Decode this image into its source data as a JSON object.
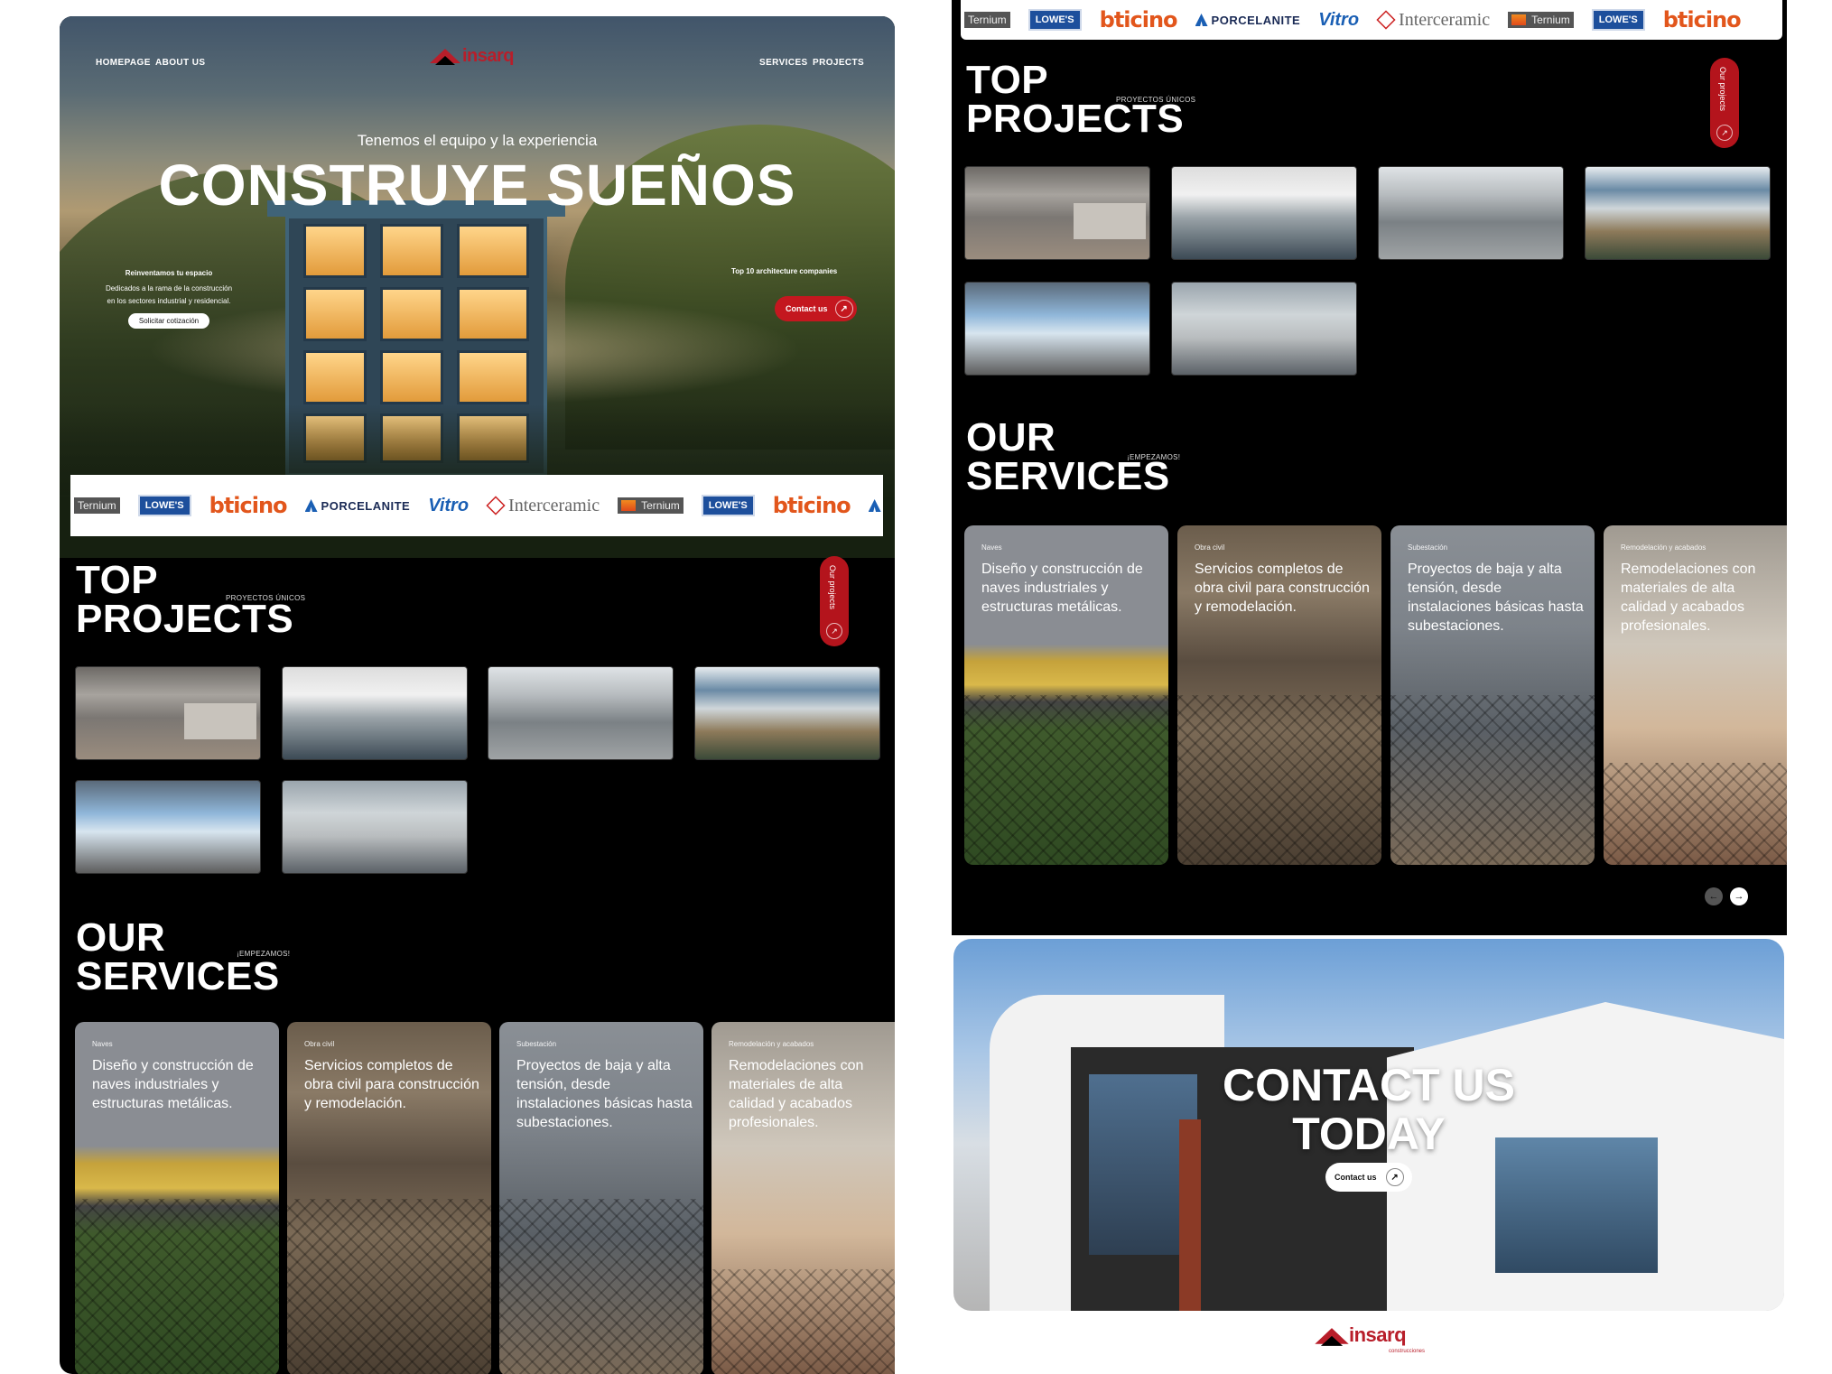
{
  "nav": {
    "left_links": [
      "HOMEPAGE",
      "ABOUT US"
    ],
    "right_links": [
      "SERVICES",
      "PROJECTS"
    ],
    "logo_text": "insarq",
    "logo_sub": "construcciones"
  },
  "hero": {
    "subtitle": "Tenemos el equipo y la experiencia",
    "title": "CONSTRUYE SUEÑOS",
    "left_heading": "Reinventamos tu espacio",
    "left_desc_1": "Dedicados a la rama de la construcción",
    "left_desc_2": "en los sectores industrial y residencial.",
    "quote_button": "Solicitar cotización",
    "right_text": "Top 10 architecture companies",
    "contact_button": "Contact us"
  },
  "brands": {
    "ternium": "Ternium",
    "lowes": "LOWE'S",
    "bticino": "bticino",
    "porcelanite": "PORCELANITE",
    "vitro": "Vitro",
    "interceramic": "Interceramic"
  },
  "projects": {
    "title_line1": "TOP",
    "title_line2": "PROJECTS",
    "tag": "PROYECTOS ÚNICOS",
    "pill_label": "Our projects"
  },
  "services": {
    "title_line1": "OUR",
    "title_line2": "SERVICES",
    "tag": "¡EMPEZAMOS!",
    "cards": [
      {
        "category": "Naves",
        "text": "Diseño y construcción de naves industriales y estructuras metálicas."
      },
      {
        "category": "Obra civil",
        "text": "Servicios completos de obra civil para construcción y remodelación."
      },
      {
        "category": "Subestación",
        "text": "Proyectos de baja y alta tensión, desde instalaciones básicas hasta subestaciones."
      },
      {
        "category": "Remodelación y acabados",
        "text": "Remodelaciones con materiales de alta calidad y acabados profesionales."
      }
    ]
  },
  "contact": {
    "title_line1": "CONTACT US",
    "title_line2": "TODAY",
    "button": "Contact us"
  },
  "icons": {
    "arrow": "↗",
    "prev": "←",
    "next": "→"
  },
  "colors": {
    "brand_red": "#b81e2a",
    "pill_red": "#b4141c",
    "background_dark": "#000000"
  }
}
